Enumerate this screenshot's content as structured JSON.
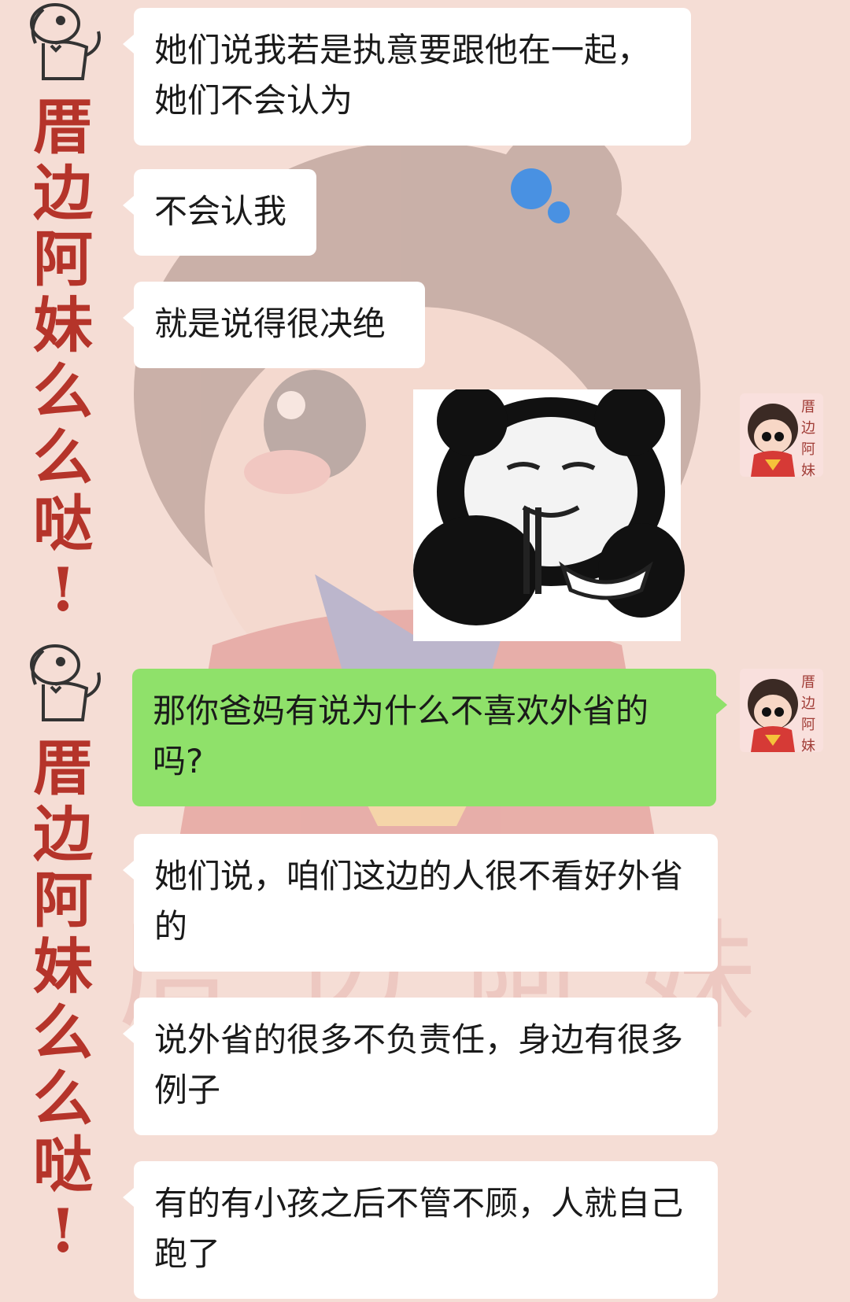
{
  "side_label": {
    "chars": [
      "厝",
      "边",
      "阿",
      "妹",
      "么",
      "么",
      "哒",
      "!"
    ]
  },
  "messages": [
    {
      "text": "她们说我若是执意要跟他在一起，她们不会认为"
    },
    {
      "text": "不会认我"
    },
    {
      "text": "就是说得很决绝"
    },
    {
      "text": "那你爸妈有说为什么不喜欢外省的吗?"
    },
    {
      "text": "她们说，咱们这边的人很不看好外省的"
    },
    {
      "text": "说外省的很多不负责任，身边有很多例子"
    },
    {
      "text": "有的有小孩之后不管不顾，人就自己跑了"
    }
  ],
  "avatar": {
    "label": "厝边阿妹"
  },
  "watermark": "厝边阿妹",
  "colors": {
    "background": "#f5ddd5",
    "incoming": "#ffffff",
    "outgoing": "#8fe16a",
    "side_text": "#b5342a"
  },
  "sticker": {
    "name": "panda-eating-sticker"
  }
}
